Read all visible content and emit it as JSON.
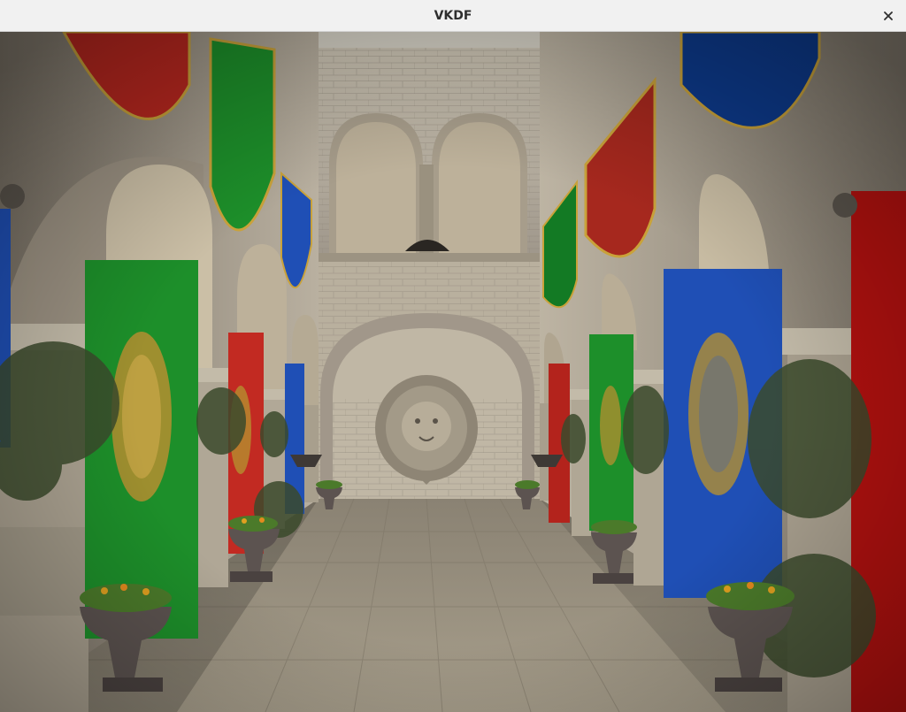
{
  "window": {
    "title": "VKDF",
    "close_icon": "close-icon"
  },
  "scene": {
    "description_icon": "rendered-3d-scene"
  },
  "colors": {
    "titlebar_bg": "#f1f1f1",
    "title_text": "#2e2e2e",
    "banner_red": "#b8271f",
    "banner_green": "#1d8f2a",
    "banner_blue": "#1f4fb5",
    "stone": "#b5ab99",
    "floor": "#9c9484"
  }
}
